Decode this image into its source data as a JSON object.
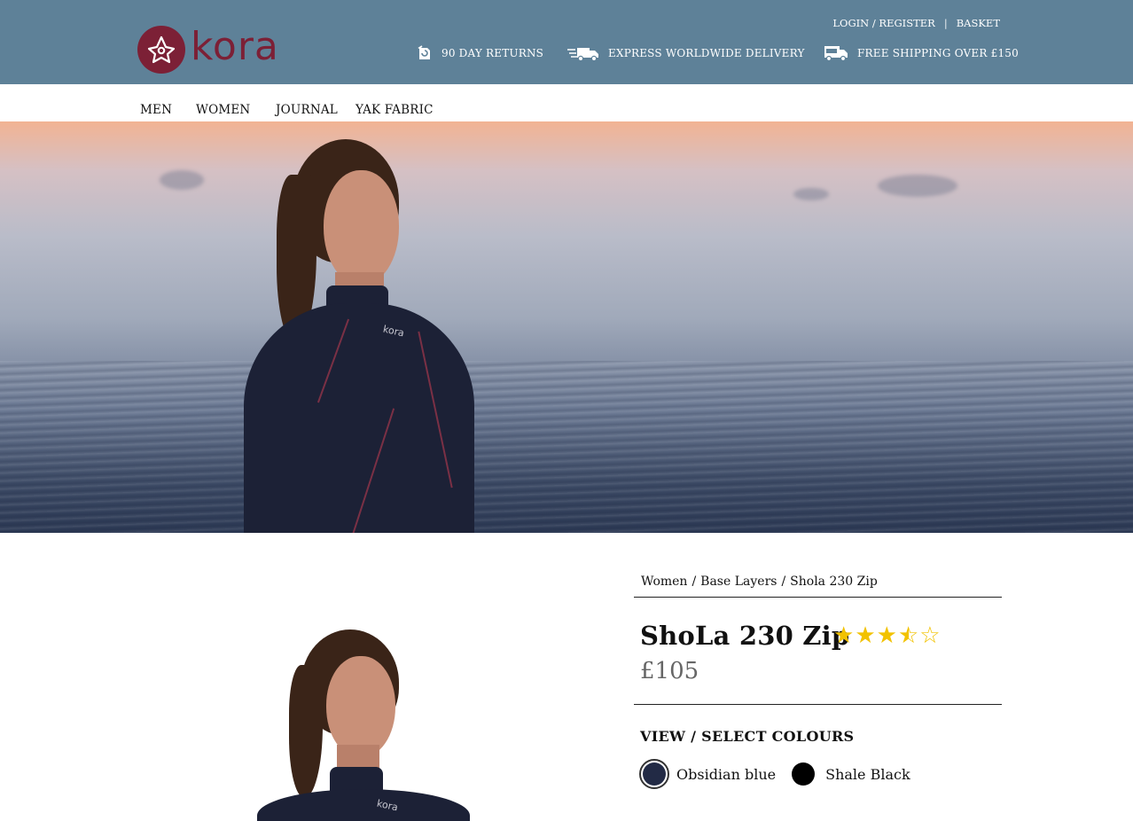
{
  "brand": {
    "name": "kora",
    "color": "#7c2036"
  },
  "header": {
    "background": "#5e8198",
    "login_label": "LOGIN / REGISTER",
    "separator": "|",
    "basket_label": "BASKET",
    "usps": [
      {
        "icon": "returns-icon",
        "label": "90 DAY RETURNS"
      },
      {
        "icon": "delivery-truck-icon",
        "label": "EXPRESS  WORLDWIDE DELIVERY"
      },
      {
        "icon": "free-shipping-van-icon",
        "label": "FREE SHIPPING OVER £150"
      }
    ]
  },
  "nav": {
    "items": [
      "MEN",
      "WOMEN",
      "JOURNAL",
      "YAK FABRIC"
    ]
  },
  "breadcrumb": {
    "items": [
      "Women",
      "Base Layers",
      "Shola 230 Zip"
    ],
    "separator": "/"
  },
  "product": {
    "title": "ShoLa 230 Zip",
    "rating": 3.5,
    "rating_max": 5,
    "price": "£105",
    "colours_heading": "VIEW / SELECT COLOURS",
    "colours": [
      {
        "name": "Obsidian blue",
        "hex": "#222a45",
        "selected": true
      },
      {
        "name": "Shale Black",
        "hex": "#000000",
        "selected": false
      }
    ],
    "garment_logo_text": "kora"
  }
}
